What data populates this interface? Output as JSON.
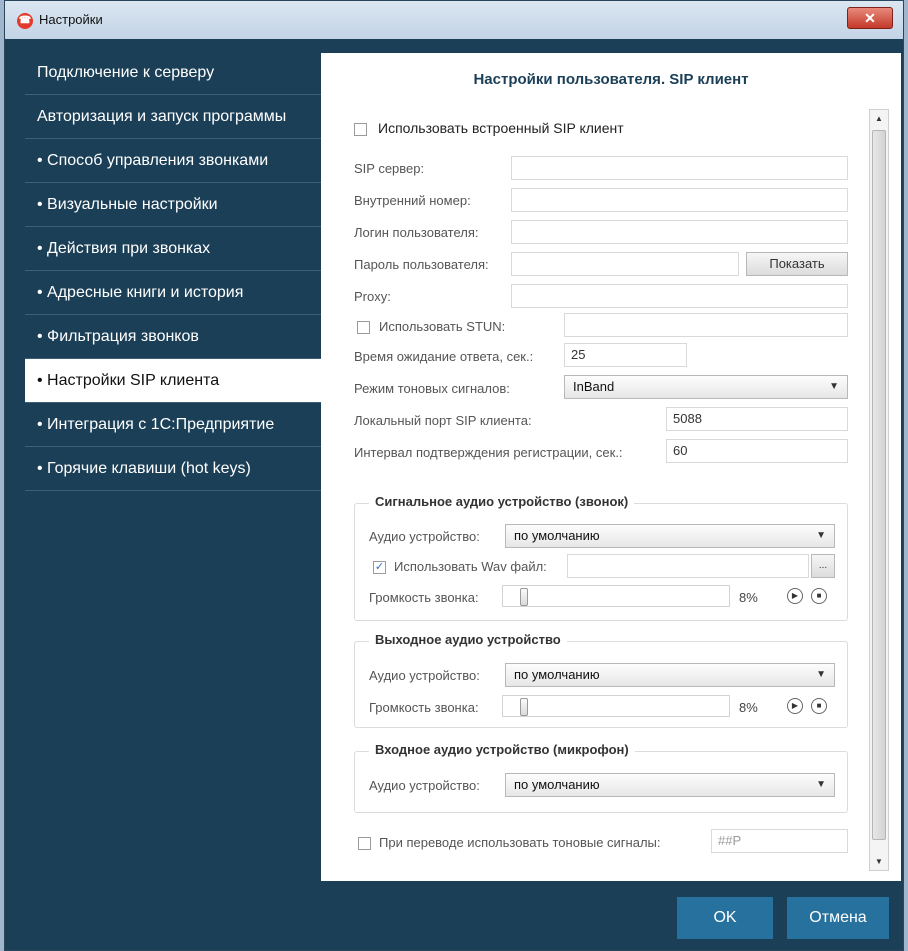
{
  "window": {
    "title": "Настройки"
  },
  "sidebar": {
    "items": [
      {
        "label": "Подключение к серверу"
      },
      {
        "label": "Авторизация и запуск программы"
      },
      {
        "label": "• Способ управления звонками"
      },
      {
        "label": "• Визуальные настройки"
      },
      {
        "label": "• Действия при звонках"
      },
      {
        "label": "• Адресные книги и история"
      },
      {
        "label": "• Фильтрация звонков"
      },
      {
        "label": "• Настройки SIP клиента",
        "active": true
      },
      {
        "label": "• Интеграция с 1С:Предприятие"
      },
      {
        "label": "• Горячие клавиши (hot keys)"
      }
    ]
  },
  "main": {
    "title": "Настройки пользователя. SIP клиент",
    "use_builtin": {
      "label": "Использовать встроенный SIP клиент",
      "checked": false
    },
    "fields": {
      "sip_server": {
        "label": "SIP сервер:",
        "value": ""
      },
      "ext_number": {
        "label": "Внутренний номер:",
        "value": ""
      },
      "login": {
        "label": "Логин пользователя:",
        "value": ""
      },
      "password": {
        "label": "Пароль пользователя:",
        "value": ""
      },
      "show_button": "Показать",
      "proxy": {
        "label": "Proxy:",
        "value": ""
      },
      "stun": {
        "label": "Использовать STUN:",
        "checked": false,
        "value": ""
      },
      "timeout": {
        "label": "Время ожидание ответа, сек.:",
        "value": "25"
      },
      "dtmf_mode": {
        "label": "Режим тоновых сигналов:",
        "value": "InBand"
      },
      "local_port": {
        "label": "Локальный порт SIP клиента:",
        "value": "5088"
      },
      "reg_interval": {
        "label": "Интервал подтверждения регистрации, сек.:",
        "value": "60"
      }
    },
    "ring_group": {
      "title": "Сигнальное аудио устройство (звонок)",
      "device_label": "Аудио устройство:",
      "device_value": "по умолчанию",
      "wav_label": "Использовать Wav файл:",
      "wav_checked": true,
      "wav_value": "",
      "browse_label": "...",
      "volume_label": "Громкость звонка:",
      "volume_percent": "8%",
      "volume_level": 0.08
    },
    "out_group": {
      "title": "Выходное аудио устройство",
      "device_label": "Аудио устройство:",
      "device_value": "по умолчанию",
      "volume_label": "Громкость звонка:",
      "volume_percent": "8%",
      "volume_level": 0.08
    },
    "in_group": {
      "title": "Входное аудио устройство (микрофон)",
      "device_label": "Аудио устройство:",
      "device_value": "по умолчанию"
    },
    "transfer": {
      "label": "При переводе использовать тоновые сигналы:",
      "checked": false,
      "value": "##P"
    }
  },
  "footer": {
    "ok": "OK",
    "cancel": "Отмена"
  },
  "colors": {
    "sidebar_bg": "#1b3f57",
    "active_item_bg": "#ffffff",
    "button_bg": "#26719e",
    "title_color": "#1b3f57"
  }
}
